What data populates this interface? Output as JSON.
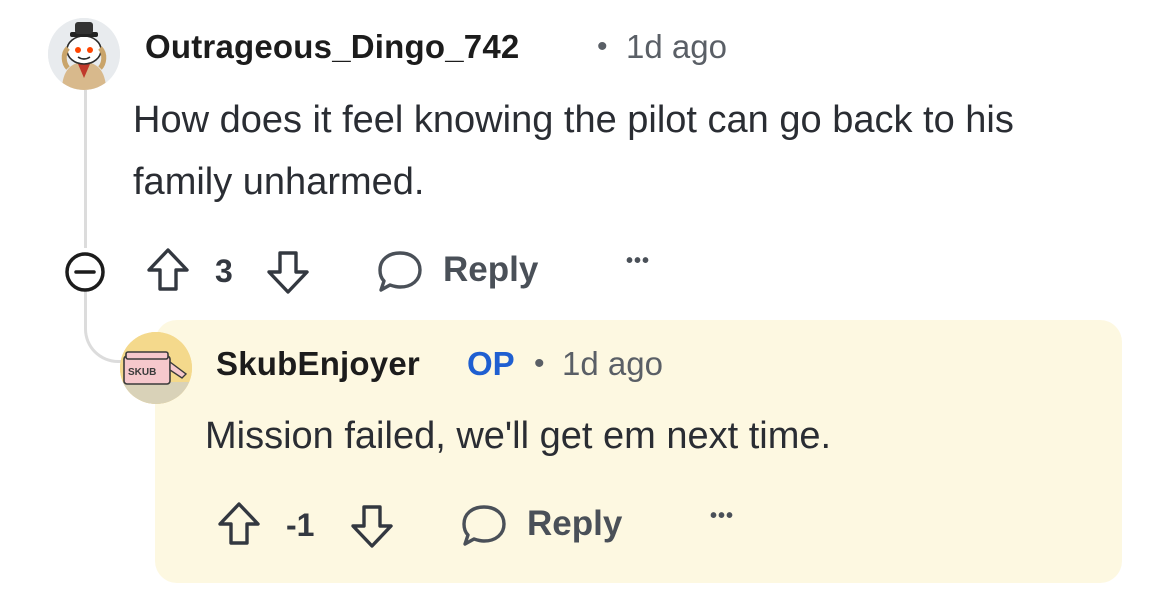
{
  "comment": {
    "username": "Outrageous_Dingo_742",
    "separator": "•",
    "time": "1d ago",
    "body": "How does it feel knowing the pilot can go back to his family unharmed.",
    "votes": "3",
    "reply_label": "Reply",
    "more_label": "•••",
    "avatar_icon": "snoo-avatar-icon"
  },
  "reply": {
    "username": "SkubEnjoyer",
    "op_badge": "OP",
    "separator": "•",
    "time": "1d ago",
    "body": "Mission failed, we'll get em next time.",
    "votes": "-1",
    "reply_label": "Reply",
    "more_label": "•••",
    "avatar_text": "SKUB",
    "highlight_color": "#fdf8e1"
  },
  "colors": {
    "op_badge": "#1f5fd1",
    "meta_text": "#5a5f66",
    "thread_line": "#dcdcdc"
  }
}
